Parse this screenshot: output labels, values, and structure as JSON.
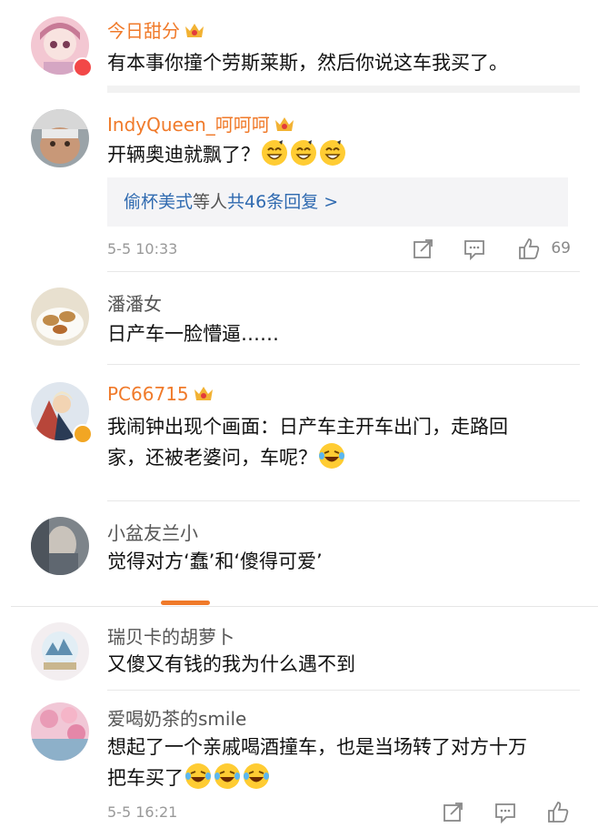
{
  "comments": [
    {
      "user": "今日甜分",
      "text": "有本事你撞个劳斯莱斯，然后你说这车我买了。"
    },
    {
      "user": "IndyQueen_呵呵呵",
      "text": "开辆奥迪就飘了？",
      "reply_box": {
        "names": "偷杯美式",
        "middle": "等人",
        "count": "共46条回复 >"
      },
      "time": "5-5 10:33",
      "likes": "69"
    },
    {
      "user": "潘潘女",
      "text": "日产车一脸懵逼……"
    },
    {
      "user": "PC66715",
      "text_line1": "我闹钟出现个画面：日产车主开车出门，走路回",
      "text_line2": "家，还被老婆问，车呢？"
    },
    {
      "user": "小盆友兰小",
      "text": "觉得对方‘蠢’和‘傻得可爱’"
    },
    {
      "user": "瑞贝卡的胡萝卜",
      "text": "又傻又有钱的我为什么遇不到"
    },
    {
      "user": "爱喝奶茶的smile",
      "text_line1": "想起了一个亲戚喝酒撞车，也是当场转了对方十万",
      "text_line2": "把车买了",
      "time": "5-5 16:21"
    }
  ],
  "icons": {
    "share": "share-icon",
    "comment": "comment-icon",
    "like": "like-icon",
    "crown": "crown-icon",
    "laugh": "laughing-emoji",
    "grin": "grin-emoji"
  },
  "colors": {
    "accent": "#f07a2a",
    "link": "#2f6ab0",
    "muted": "#999999"
  }
}
